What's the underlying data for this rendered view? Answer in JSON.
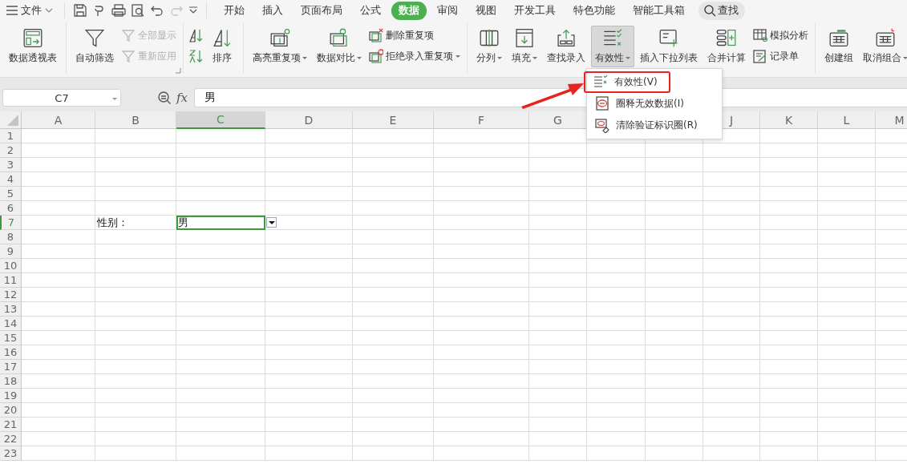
{
  "title_bar": {
    "menu_label": "文件",
    "quick_access": [
      {
        "disabled": false
      },
      {
        "disabled": false
      },
      {
        "disabled": false
      },
      {
        "disabled": false
      },
      {
        "disabled": false
      },
      {
        "disabled": true
      }
    ],
    "tabs": [
      {
        "label": "开始",
        "selected": false
      },
      {
        "label": "插入",
        "selected": false
      },
      {
        "label": "页面布局",
        "selected": false
      },
      {
        "label": "公式",
        "selected": false
      },
      {
        "label": "数据",
        "selected": true
      },
      {
        "label": "审阅",
        "selected": false
      },
      {
        "label": "视图",
        "selected": false
      },
      {
        "label": "开发工具",
        "selected": false
      },
      {
        "label": "特色功能",
        "selected": false
      },
      {
        "label": "智能工具箱",
        "selected": false
      }
    ],
    "search": "查找"
  },
  "ribbon": {
    "groups": [
      {
        "launcher": false,
        "items": [
          {
            "kind": "large",
            "label": "数据透视表",
            "dropdown": false,
            "pressed": false
          }
        ]
      },
      {
        "launcher": true,
        "items": [
          {
            "kind": "large",
            "label": "自动筛选",
            "dropdown": false,
            "pressed": false
          },
          {
            "kind": "stack",
            "items": [
              {
                "label": "全部显示",
                "disabled": true,
                "dropdown": false
              },
              {
                "label": "重新应用",
                "disabled": true,
                "dropdown": false
              }
            ]
          }
        ]
      },
      {
        "launcher": false,
        "items": [
          {
            "kind": "icon_pair"
          },
          {
            "kind": "large",
            "label": "排序",
            "dropdown": false,
            "pressed": false
          }
        ]
      },
      {
        "launcher": false,
        "items": [
          {
            "kind": "large",
            "label": "高亮重复项",
            "dropdown": true,
            "pressed": false
          },
          {
            "kind": "large",
            "label": "数据对比",
            "dropdown": true,
            "pressed": false
          },
          {
            "kind": "stack",
            "items": [
              {
                "label": "删除重复项",
                "disabled": false,
                "dropdown": false
              },
              {
                "label": "拒绝录入重复项",
                "disabled": false,
                "dropdown": true
              }
            ]
          }
        ]
      },
      {
        "launcher": false,
        "items": [
          {
            "kind": "large",
            "label": "分列",
            "dropdown": true,
            "pressed": false
          },
          {
            "kind": "large",
            "label": "填充",
            "dropdown": true,
            "pressed": false
          },
          {
            "kind": "large",
            "label": "查找录入",
            "dropdown": false,
            "pressed": false
          },
          {
            "kind": "large",
            "label": "有效性",
            "dropdown": true,
            "pressed": true
          },
          {
            "kind": "large",
            "label": "插入下拉列表",
            "dropdown": false,
            "pressed": false
          },
          {
            "kind": "large",
            "label": "合并计算",
            "dropdown": false,
            "pressed": false
          },
          {
            "kind": "stack",
            "items": [
              {
                "label": "模拟分析",
                "disabled": false,
                "dropdown": false
              },
              {
                "label": "记录单",
                "disabled": false,
                "dropdown": false
              }
            ]
          }
        ]
      },
      {
        "launcher": false,
        "items": [
          {
            "kind": "large",
            "label": "创建组",
            "dropdown": false,
            "pressed": false
          },
          {
            "kind": "large",
            "label": "取消组合",
            "dropdown": true,
            "pressed": false
          }
        ]
      }
    ]
  },
  "formula_bar": {
    "name_box": "C7",
    "fx": "fx",
    "value": "男"
  },
  "sheet": {
    "columns": [
      {
        "label": "A",
        "selected": false
      },
      {
        "label": "B",
        "selected": false
      },
      {
        "label": "C",
        "selected": true
      },
      {
        "label": "D",
        "selected": false
      },
      {
        "label": "E",
        "selected": false
      },
      {
        "label": "F",
        "selected": false
      },
      {
        "label": "G",
        "selected": false
      },
      null,
      null,
      {
        "label": "J",
        "selected": false
      },
      {
        "label": "K",
        "selected": false
      },
      {
        "label": "L",
        "selected": false
      },
      {
        "label": "M",
        "selected": false
      }
    ],
    "rows": [
      {
        "label": "1",
        "selected": false
      },
      {
        "label": "2",
        "selected": false
      },
      {
        "label": "3",
        "selected": false
      },
      {
        "label": "4",
        "selected": false
      },
      {
        "label": "5",
        "selected": false
      },
      {
        "label": "6",
        "selected": false
      },
      {
        "label": "7",
        "selected": true,
        "cells": [
          null,
          {
            "text": "性别：",
            "selected": false,
            "dropdown": false
          },
          {
            "text": "男",
            "selected": true,
            "dropdown": true
          }
        ]
      },
      {
        "label": "8",
        "selected": false
      },
      {
        "label": "9",
        "selected": false
      },
      {
        "label": "10",
        "selected": false
      },
      {
        "label": "11",
        "selected": false
      },
      {
        "label": "12",
        "selected": false
      },
      {
        "label": "13",
        "selected": false
      },
      {
        "label": "14",
        "selected": false
      },
      {
        "label": "15",
        "selected": false
      },
      {
        "label": "16",
        "selected": false
      },
      {
        "label": "17",
        "selected": false
      },
      {
        "label": "18",
        "selected": false
      },
      {
        "label": "19",
        "selected": false
      },
      {
        "label": "20",
        "selected": false
      },
      {
        "label": "21",
        "selected": false
      },
      {
        "label": "22",
        "selected": false
      },
      {
        "label": "23",
        "selected": false
      }
    ]
  },
  "dropdown_menu": {
    "items": [
      {
        "label": "有效性(V)",
        "highlighted": true
      },
      {
        "label": "圈释无效数据(I)",
        "highlighted": false
      },
      {
        "label": "清除验证标识圈(R)",
        "highlighted": false
      }
    ]
  }
}
